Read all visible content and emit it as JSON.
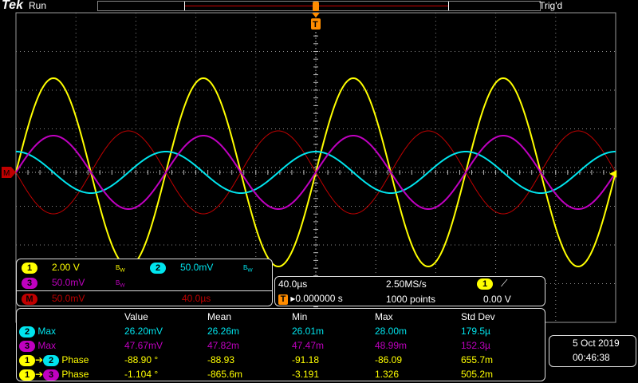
{
  "header": {
    "brand": "Tek",
    "run_state": "Run",
    "trigger_state": "Trig'd",
    "trigger_marker": "T"
  },
  "markers": {
    "math_ground": "M",
    "trigger_level": "◀"
  },
  "colors": {
    "ch1": "#ffff00",
    "ch2": "#00e5ee",
    "ch3": "#c000c0",
    "math": "#c00000",
    "grid": "#8a8a8a",
    "trigger_marker": "#ff8c00"
  },
  "channels": {
    "ch1": {
      "label": "1",
      "scale": "2.00 V",
      "bw": "B_W"
    },
    "ch2": {
      "label": "2",
      "scale": "50.0mV",
      "bw": "B_W"
    },
    "ch3": {
      "label": "3",
      "scale": "50.0mV",
      "bw": "B_W"
    },
    "math": {
      "label": "M",
      "scale": "50.0mV",
      "time": "40.0µs"
    }
  },
  "timebase": {
    "horizontal_scale": "40.0µs",
    "sample_rate": "2.50MS/s",
    "trigger_source": "1",
    "trigger_slope": "⟋",
    "trigger_position_label": "T",
    "trigger_position": "▸0.000000 s",
    "record_length": "1000 points",
    "trigger_level": "0.00 V"
  },
  "measurements": {
    "headers": [
      "Value",
      "Mean",
      "Min",
      "Max",
      "Std Dev"
    ],
    "rows": [
      {
        "ch_a": "2",
        "ch_b": "",
        "name": "Max",
        "value": "26.20mV",
        "mean": "26.26m",
        "min": "26.01m",
        "max": "28.00m",
        "std": "179.5µ"
      },
      {
        "ch_a": "3",
        "ch_b": "",
        "name": "Max",
        "value": "47.67mV",
        "mean": "47.82m",
        "min": "47.47m",
        "max": "48.99m",
        "std": "152.3µ"
      },
      {
        "ch_a": "1",
        "ch_b": "2",
        "name": "Phase",
        "value": "-88.90 °",
        "mean": "-88.93",
        "min": "-91.18",
        "max": "-86.09",
        "std": "655.7m"
      },
      {
        "ch_a": "1",
        "ch_b": "3",
        "name": "Phase",
        "value": "-1.104 °",
        "mean": "-865.6m",
        "min": "-3.191",
        "max": "1.326",
        "std": "505.2m"
      }
    ]
  },
  "datetime": {
    "date": "5 Oct  2019",
    "time": "00:46:38"
  }
}
